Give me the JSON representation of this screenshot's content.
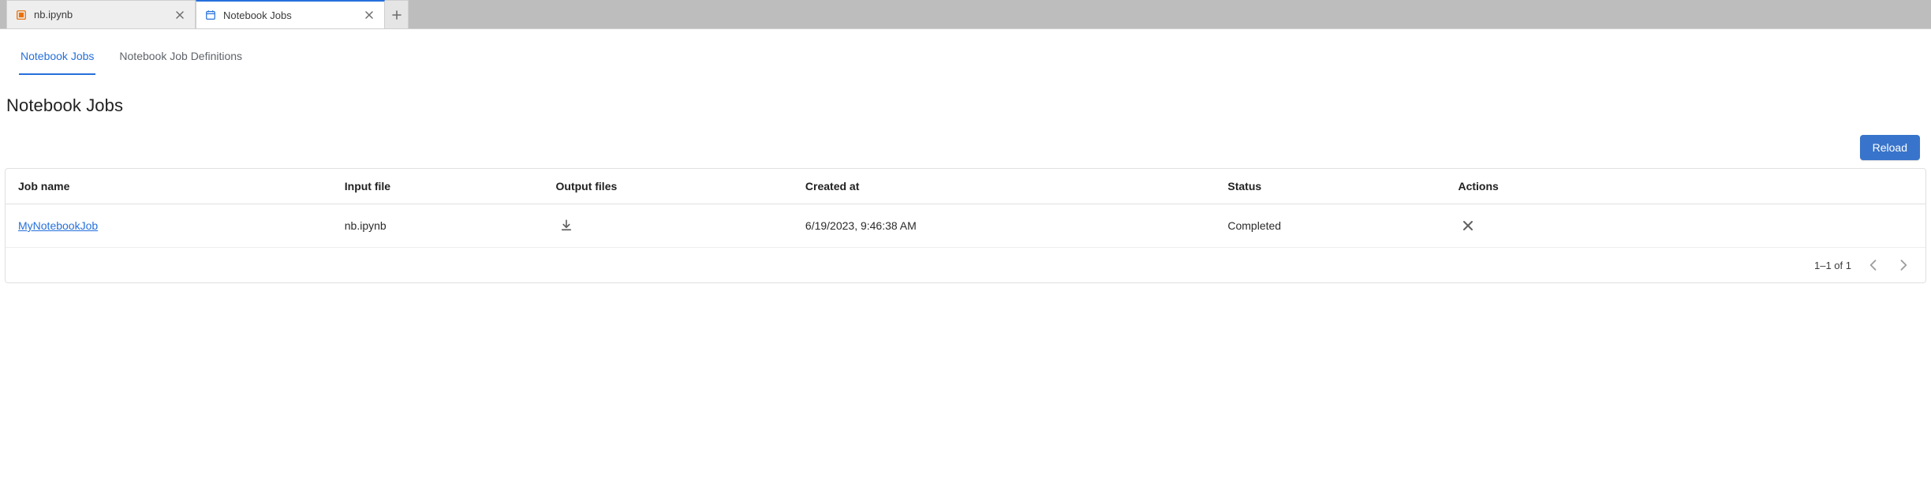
{
  "appTabs": [
    {
      "label": "nb.ipynb",
      "iconColor": "#e8710a",
      "active": false
    },
    {
      "label": "Notebook Jobs",
      "iconColor": "#2670db",
      "active": true
    }
  ],
  "innerTabs": [
    {
      "label": "Notebook Jobs",
      "active": true
    },
    {
      "label": "Notebook Job Definitions",
      "active": false
    }
  ],
  "page": {
    "title": "Notebook Jobs",
    "reloadLabel": "Reload"
  },
  "table": {
    "columns": [
      "Job name",
      "Input file",
      "Output files",
      "Created at",
      "Status",
      "Actions"
    ],
    "rows": [
      {
        "jobName": "MyNotebookJob",
        "inputFile": "nb.ipynb",
        "createdAt": "6/19/2023, 9:46:38 AM",
        "status": "Completed"
      }
    ]
  },
  "pagination": {
    "rangeText": "1–1 of 1"
  }
}
